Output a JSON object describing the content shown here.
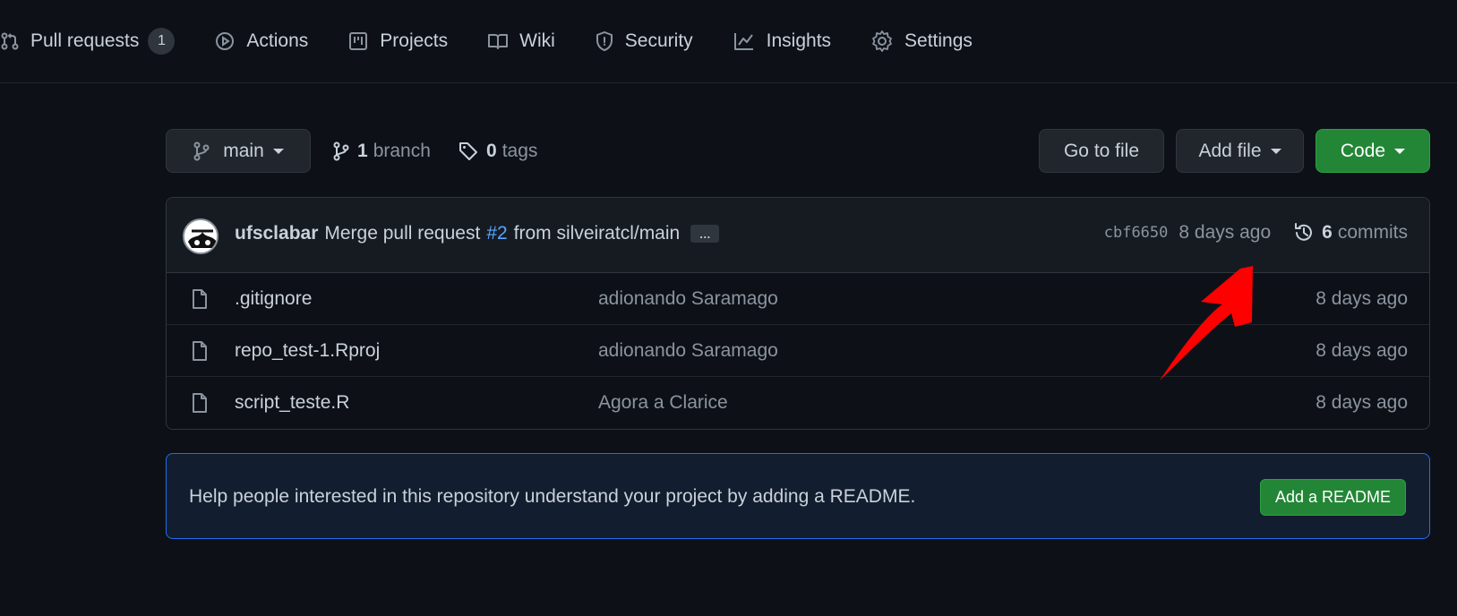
{
  "nav": {
    "items": [
      {
        "label": "Pull requests",
        "count": "1"
      },
      {
        "label": "Actions"
      },
      {
        "label": "Projects"
      },
      {
        "label": "Wiki"
      },
      {
        "label": "Security"
      },
      {
        "label": "Insights"
      },
      {
        "label": "Settings"
      }
    ]
  },
  "controls": {
    "branch": "main",
    "branch_count": "1",
    "branch_label": "branch",
    "tag_count": "0",
    "tag_label": "tags",
    "go_to_file": "Go to file",
    "add_file": "Add file",
    "code": "Code"
  },
  "commit": {
    "author": "ufsclabar",
    "message_prefix": "Merge pull request",
    "pr": "#2",
    "message_suffix": "from silveiratcl/main",
    "ellipsis": "…",
    "sha": "cbf6650",
    "time": "8 days ago",
    "commit_count": "6",
    "commit_label": "commits"
  },
  "files": [
    {
      "name": ".gitignore",
      "commit": "adionando Saramago",
      "age": "8 days ago"
    },
    {
      "name": "repo_test-1.Rproj",
      "commit": "adionando Saramago",
      "age": "8 days ago"
    },
    {
      "name": "script_teste.R",
      "commit": "Agora a Clarice",
      "age": "8 days ago"
    }
  ],
  "readme": {
    "message": "Help people interested in this repository understand your project by adding a README.",
    "button": "Add a README"
  },
  "colors": {
    "background": "#0d1117",
    "accent_green": "#238636",
    "link_blue": "#58a6ff",
    "annotation_red": "#ff0000"
  }
}
